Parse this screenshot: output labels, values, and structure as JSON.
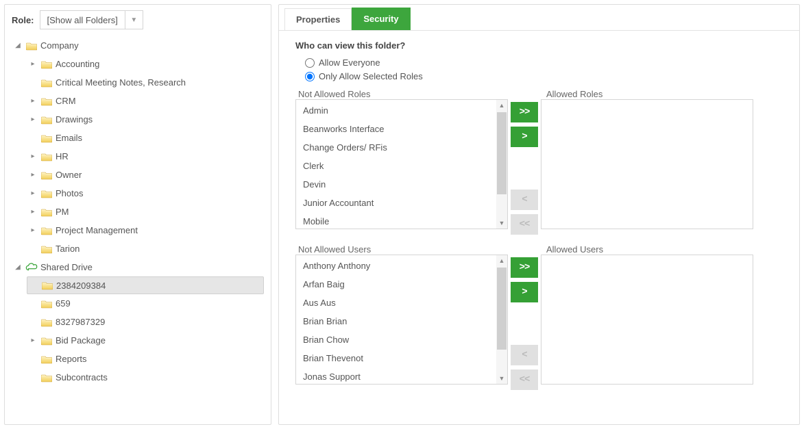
{
  "role": {
    "label": "Role:",
    "value": "[Show all Folders]"
  },
  "tree": {
    "company": {
      "label": "Company",
      "children": [
        {
          "key": "accounting",
          "label": "Accounting",
          "hasChildren": true
        },
        {
          "key": "notes",
          "label": "Critical Meeting Notes, Research",
          "hasChildren": false
        },
        {
          "key": "crm",
          "label": "CRM",
          "hasChildren": true
        },
        {
          "key": "drawings",
          "label": "Drawings",
          "hasChildren": true
        },
        {
          "key": "emails",
          "label": "Emails",
          "hasChildren": false
        },
        {
          "key": "hr",
          "label": "HR",
          "hasChildren": true
        },
        {
          "key": "owner",
          "label": "Owner",
          "hasChildren": true
        },
        {
          "key": "photos",
          "label": "Photos",
          "hasChildren": true
        },
        {
          "key": "pm",
          "label": "PM",
          "hasChildren": true
        },
        {
          "key": "projmgmt",
          "label": "Project Management",
          "hasChildren": true
        },
        {
          "key": "tarion",
          "label": "Tarion",
          "hasChildren": false
        }
      ]
    },
    "shared": {
      "label": "Shared Drive",
      "children": [
        {
          "key": "n2384",
          "label": "2384209384",
          "hasChildren": false,
          "selected": true
        },
        {
          "key": "n659",
          "label": "659",
          "hasChildren": false
        },
        {
          "key": "n8327",
          "label": "8327987329",
          "hasChildren": false
        },
        {
          "key": "bid",
          "label": "Bid Package",
          "hasChildren": true
        },
        {
          "key": "reports",
          "label": "Reports",
          "hasChildren": false
        },
        {
          "key": "subs",
          "label": "Subcontracts",
          "hasChildren": false
        }
      ]
    }
  },
  "tabs": {
    "properties": "Properties",
    "security": "Security",
    "active": "security"
  },
  "security": {
    "question": "Who can view this folder?",
    "opt_everyone": "Allow Everyone",
    "opt_selected": "Only Allow Selected Roles",
    "labels": {
      "not_allowed_roles": "Not Allowed Roles",
      "allowed_roles": "Allowed Roles",
      "not_allowed_users": "Not Allowed Users",
      "allowed_users": "Allowed Users"
    },
    "not_allowed_roles": [
      "Admin",
      "Beanworks Interface",
      "Change Orders/ RFis",
      "Clerk",
      "Devin",
      "Junior Accountant",
      "Mobile"
    ],
    "allowed_roles": [],
    "not_allowed_users": [
      "Anthony Anthony",
      "Arfan Baig",
      "Aus Aus",
      "Brian Brian",
      "Brian Chow",
      "Brian Thevenot",
      "Jonas Support"
    ],
    "allowed_users": [],
    "buttons": {
      "add_all": ">>",
      "add": ">",
      "remove": "<",
      "remove_all": "<<"
    }
  }
}
